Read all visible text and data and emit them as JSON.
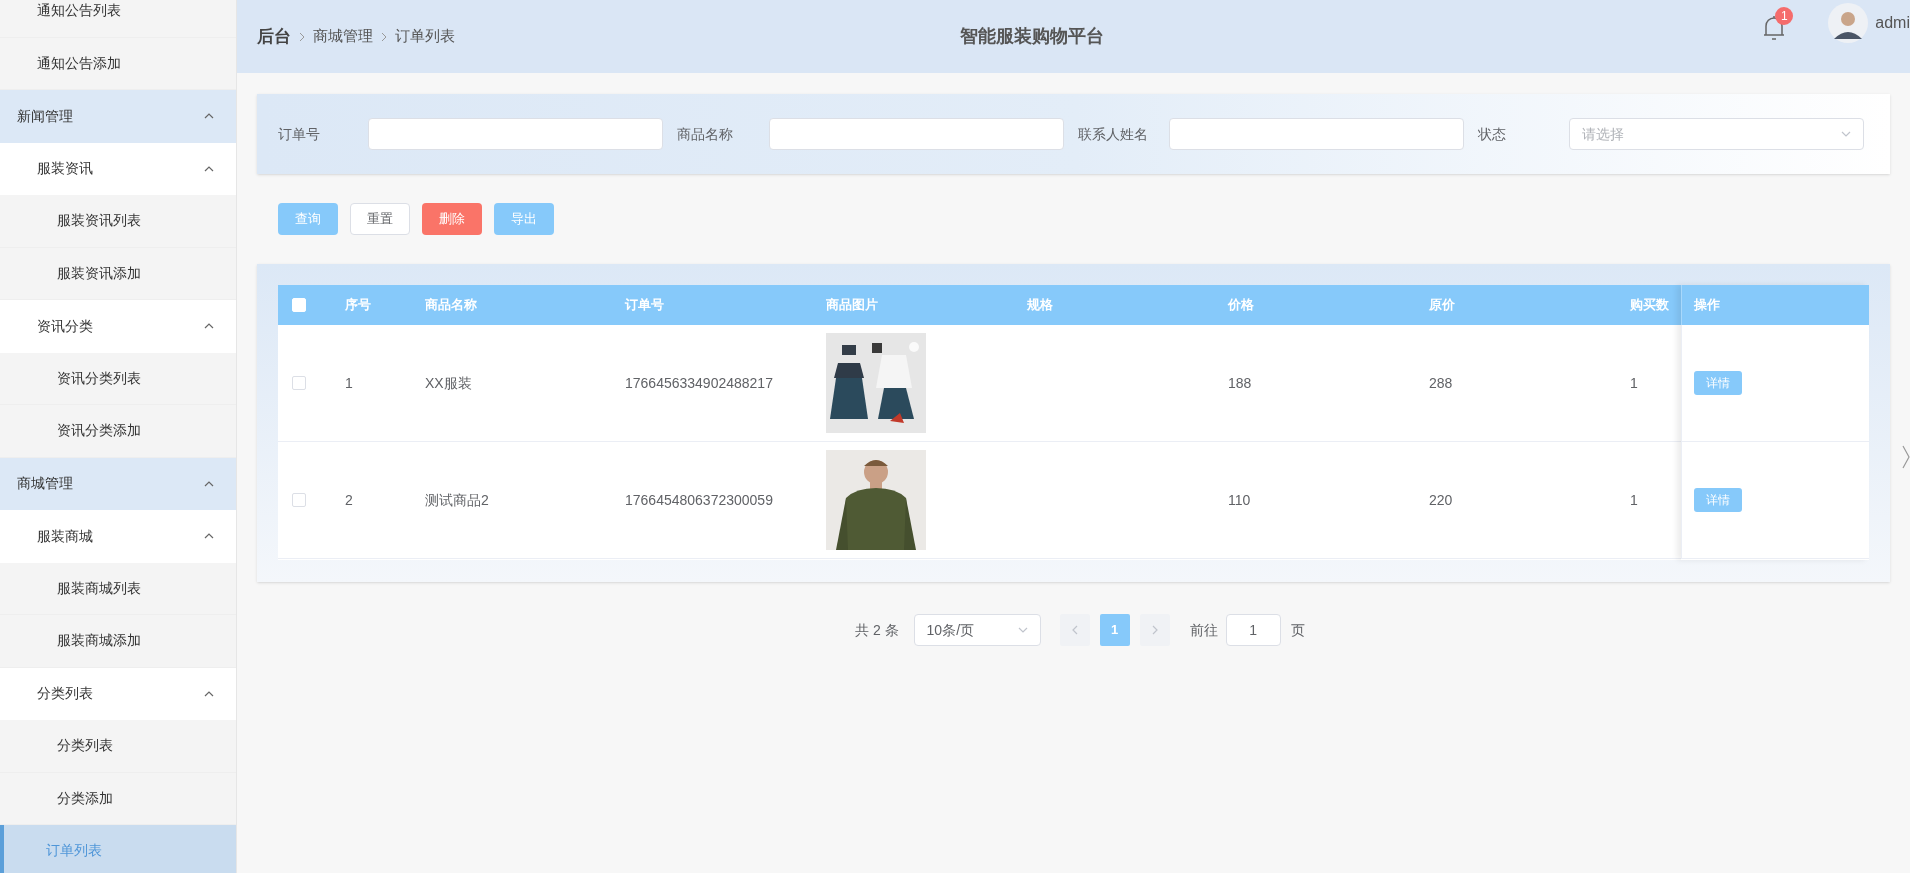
{
  "sidebar": {
    "items": [
      {
        "children": [
          {
            "label": "通知公告列表",
            "selected": false
          },
          {
            "label": "通知公告添加",
            "selected": false
          }
        ]
      },
      {
        "label": "新闻管理",
        "expanded": true,
        "children": [
          {
            "label": "服装资讯",
            "expanded": true,
            "children": [
              {
                "label": "服装资讯列表",
                "selected": false
              },
              {
                "label": "服装资讯添加",
                "selected": false
              }
            ]
          },
          {
            "label": "资讯分类",
            "expanded": true,
            "children": [
              {
                "label": "资讯分类列表",
                "selected": false
              },
              {
                "label": "资讯分类添加",
                "selected": false
              }
            ]
          }
        ]
      },
      {
        "label": "商城管理",
        "expanded": true,
        "children": [
          {
            "label": "服装商城",
            "expanded": true,
            "children": [
              {
                "label": "服装商城列表",
                "selected": false
              },
              {
                "label": "服装商城添加",
                "selected": false
              }
            ]
          },
          {
            "label": "分类列表",
            "expanded": true,
            "children": [
              {
                "label": "分类列表",
                "selected": false
              },
              {
                "label": "分类添加",
                "selected": false
              }
            ]
          },
          {
            "label": "订单列表",
            "selected": true
          }
        ]
      }
    ]
  },
  "header": {
    "breadcrumb": [
      "后台",
      "商城管理",
      "订单列表"
    ],
    "title": "智能服装购物平台",
    "notification_count": "1",
    "user": "admi"
  },
  "search": {
    "fields": [
      {
        "label": "订单号",
        "kind": "input"
      },
      {
        "label": "商品名称",
        "kind": "input"
      },
      {
        "label": "联系人姓名",
        "kind": "input"
      },
      {
        "label": "状态",
        "kind": "select",
        "placeholder": "请选择"
      }
    ]
  },
  "actions": [
    {
      "label": "查询",
      "kind": "primary"
    },
    {
      "label": "重置",
      "kind": "default"
    },
    {
      "label": "删除",
      "kind": "danger"
    },
    {
      "label": "导出",
      "kind": "primary"
    }
  ],
  "table": {
    "select_all_checked": false,
    "columns": [
      "序号",
      "商品名称",
      "订单号",
      "商品图片",
      "规格",
      "价格",
      "原价",
      "购买数"
    ],
    "action_column": "操作",
    "rows": [
      {
        "checked": false,
        "index": "1",
        "name": "XX服装",
        "order_no": "1766456334902488217",
        "price": "188",
        "original_price": "288",
        "quantity": "1",
        "action": "详情"
      },
      {
        "checked": false,
        "index": "2",
        "name": "测试商品2",
        "order_no": "1766454806372300059",
        "price": "110",
        "original_price": "220",
        "quantity": "1",
        "action": "详情"
      }
    ]
  },
  "pagination": {
    "total": "共 2 条",
    "page_size": "10条/页",
    "pages": [
      {
        "label": "1",
        "selected": true
      }
    ],
    "goto_label": "前往",
    "goto_value": "1",
    "page_suffix": "页"
  }
}
